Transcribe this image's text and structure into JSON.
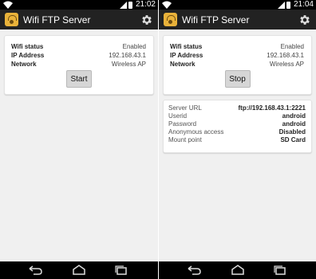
{
  "status_bar": {
    "left_time": "21:02",
    "right_time": "21:04"
  },
  "app": {
    "title": "Wifi FTP Server",
    "settings_icon": "gear-icon",
    "icon": "wifi-ftp-app-icon"
  },
  "left": {
    "info": [
      {
        "label": "Wifi status",
        "value": "Enabled"
      },
      {
        "label": "IP Address",
        "value": "192.168.43.1"
      },
      {
        "label": "Network",
        "value": "Wireless AP"
      }
    ],
    "button_label": "Start"
  },
  "right": {
    "info": [
      {
        "label": "Wifi status",
        "value": "Enabled"
      },
      {
        "label": "IP Address",
        "value": "192.168.43.1"
      },
      {
        "label": "Network",
        "value": "Wireless AP"
      }
    ],
    "button_label": "Stop",
    "server": [
      {
        "label": "Server URL",
        "value": "ftp://192.168.43.1:2221"
      },
      {
        "label": "Userid",
        "value": "android"
      },
      {
        "label": "Password",
        "value": "android"
      },
      {
        "label": "Anonymous access",
        "value": "Disabled"
      },
      {
        "label": "Mount point",
        "value": "SD Card"
      }
    ]
  },
  "nav": {
    "back_icon": "back-icon",
    "home_icon": "home-icon",
    "recent_icon": "recent-apps-icon"
  }
}
